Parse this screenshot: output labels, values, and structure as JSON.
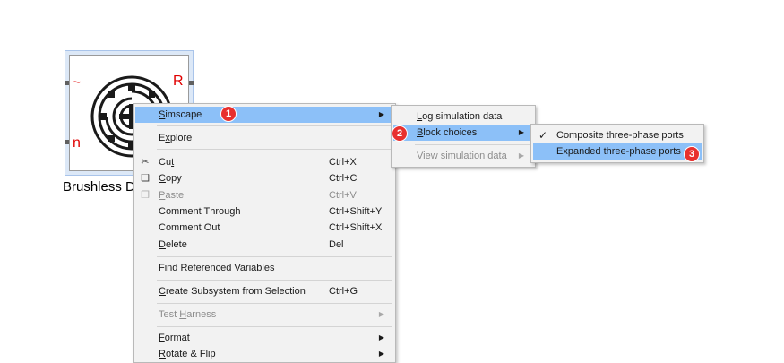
{
  "block": {
    "name": "Brushless DC Motor",
    "left_port_top": "~",
    "left_port_bottom": "n",
    "right_port": "R"
  },
  "context_menu": {
    "items": [
      {
        "label": "Simscape",
        "underline_index": 0,
        "has_submenu": true,
        "highlighted": true
      },
      {
        "label": "Explore",
        "underline_index": 1
      },
      {
        "label": "Cut",
        "shortcut": "Ctrl+X",
        "icon": "scissors-icon",
        "underline_index": 2
      },
      {
        "label": "Copy",
        "shortcut": "Ctrl+C",
        "icon": "copy-icon",
        "underline_index": 0
      },
      {
        "label": "Paste",
        "shortcut": "Ctrl+V",
        "icon": "paste-icon",
        "disabled": true,
        "underline_index": 0
      },
      {
        "label": "Comment Through",
        "shortcut": "Ctrl+Shift+Y"
      },
      {
        "label": "Comment Out",
        "shortcut": "Ctrl+Shift+X"
      },
      {
        "label": "Delete",
        "shortcut": "Del",
        "underline_index": 0
      },
      {
        "label": "Find Referenced Variables",
        "underline_index": 16
      },
      {
        "label": "Create Subsystem from Selection",
        "shortcut": "Ctrl+G",
        "underline_index": 0
      },
      {
        "label": "Test Harness",
        "has_submenu": true,
        "disabled": true,
        "underline_index": 5
      },
      {
        "label": "Format",
        "has_submenu": true,
        "underline_index": 0
      },
      {
        "label": "Rotate & Flip",
        "has_submenu": true,
        "underline_index": 0
      }
    ]
  },
  "simscape_submenu": {
    "items": [
      {
        "label": "Log simulation data",
        "underline_index": 0
      },
      {
        "label": "Block choices",
        "has_submenu": true,
        "highlighted": true,
        "underline_index": 0
      },
      {
        "label": "View simulation data",
        "has_submenu": true,
        "disabled": true,
        "underline_index": 16
      }
    ]
  },
  "block_choices_submenu": {
    "items": [
      {
        "label": "Composite three-phase ports",
        "checked": true
      },
      {
        "label": "Expanded three-phase ports",
        "highlighted": true
      }
    ]
  },
  "badges": [
    "1",
    "2",
    "3"
  ],
  "colors": {
    "highlight": "#8cc0f8",
    "badge": "#e8302e",
    "port_mark": "#e00000",
    "menu_bg": "#f2f2f2"
  }
}
